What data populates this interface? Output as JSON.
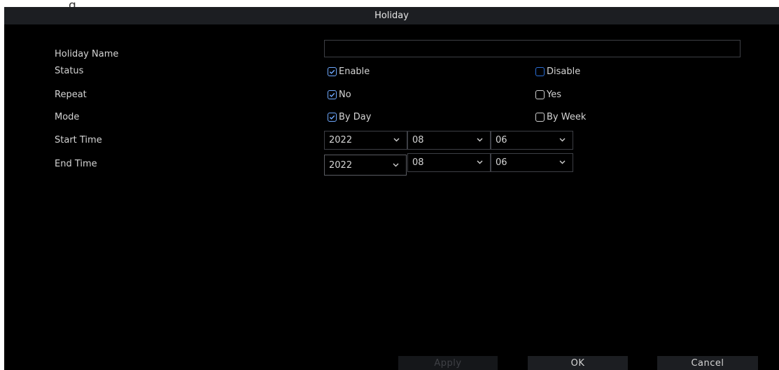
{
  "top_strip_text": "g",
  "dialog": {
    "title": "Holiday"
  },
  "form": {
    "holiday_name": {
      "label": "Holiday Name",
      "value": ""
    },
    "status": {
      "label": "Status",
      "options": [
        {
          "label": "Enable",
          "checked": true
        },
        {
          "label": "Disable",
          "checked": false
        }
      ]
    },
    "repeat": {
      "label": "Repeat",
      "options": [
        {
          "label": "No",
          "checked": true
        },
        {
          "label": "Yes",
          "checked": false
        }
      ]
    },
    "mode": {
      "label": "Mode",
      "options": [
        {
          "label": "By Day",
          "checked": true
        },
        {
          "label": "By Week",
          "checked": false
        }
      ]
    },
    "start_time": {
      "label": "Start Time",
      "year": "2022",
      "month": "08",
      "day": "06"
    },
    "end_time": {
      "label": "End Time",
      "year": "2022",
      "month": "08",
      "day": "06"
    }
  },
  "buttons": {
    "apply": "Apply",
    "ok": "OK",
    "cancel": "Cancel"
  },
  "colors": {
    "background": "#000000",
    "titlebar": "#1c1e22",
    "checkbox_checked": "#6fa9ff",
    "checkbox_focus": "#2b6fd8"
  }
}
